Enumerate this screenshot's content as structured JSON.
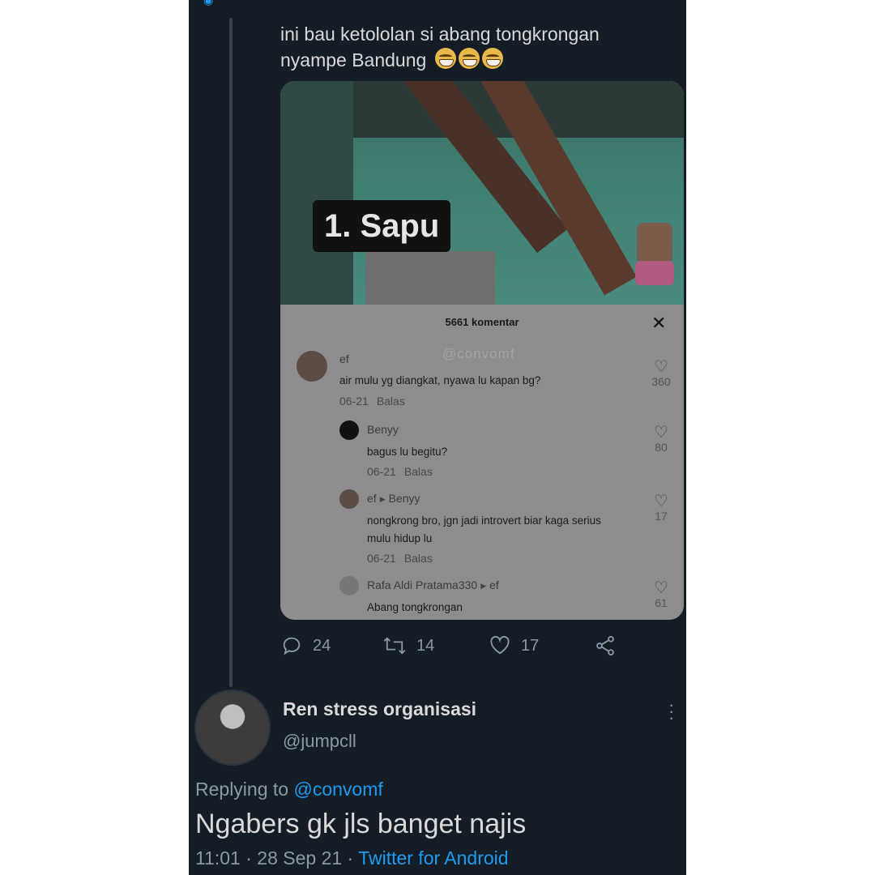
{
  "tweet": {
    "text": "ini bau ketololan si abang tongkrongan nyampe Bandung",
    "emojis": [
      "grimace-emoji",
      "grimace-emoji",
      "grimace-emoji"
    ]
  },
  "media": {
    "caption": "1. Sapu",
    "comments_header": "5661 komentar",
    "close_symbol": "✕",
    "watermark": "@convomf",
    "comments": [
      {
        "name": "ef",
        "text": "air mulu yg diangkat, nyawa lu kapan bg?",
        "date": "06-21",
        "reply": "Balas",
        "likes": "360"
      },
      {
        "name": "Benyy",
        "text": "bagus lu begitu?",
        "date": "06-21",
        "reply": "Balas",
        "likes": "80"
      },
      {
        "name": "ef",
        "to": "Benyy",
        "text": "nongkrong bro, jgn jadi introvert biar kaga serius mulu hidup lu",
        "date": "06-21",
        "reply": "Balas",
        "likes": "17"
      },
      {
        "name": "Rafa Aldi Pratama330",
        "to": "ef",
        "text": "Abang tongkrongan",
        "likes": "61"
      }
    ]
  },
  "actions": {
    "replies": "24",
    "retweets": "14",
    "likes": "17"
  },
  "reply": {
    "display_name": "Ren stress organisasi",
    "handle": "@jumpcll",
    "replying_prefix": "Replying to",
    "replying_to": "@convomf",
    "text": "Ngabers gk jls banget najis",
    "time": "11:01 · 28 Sep 21 · ",
    "source": "Twitter for Android"
  },
  "colors": {
    "background": "#141d26",
    "accent": "#1d9bf0",
    "muted": "#8b98a5",
    "text": "#d9d9d9"
  }
}
